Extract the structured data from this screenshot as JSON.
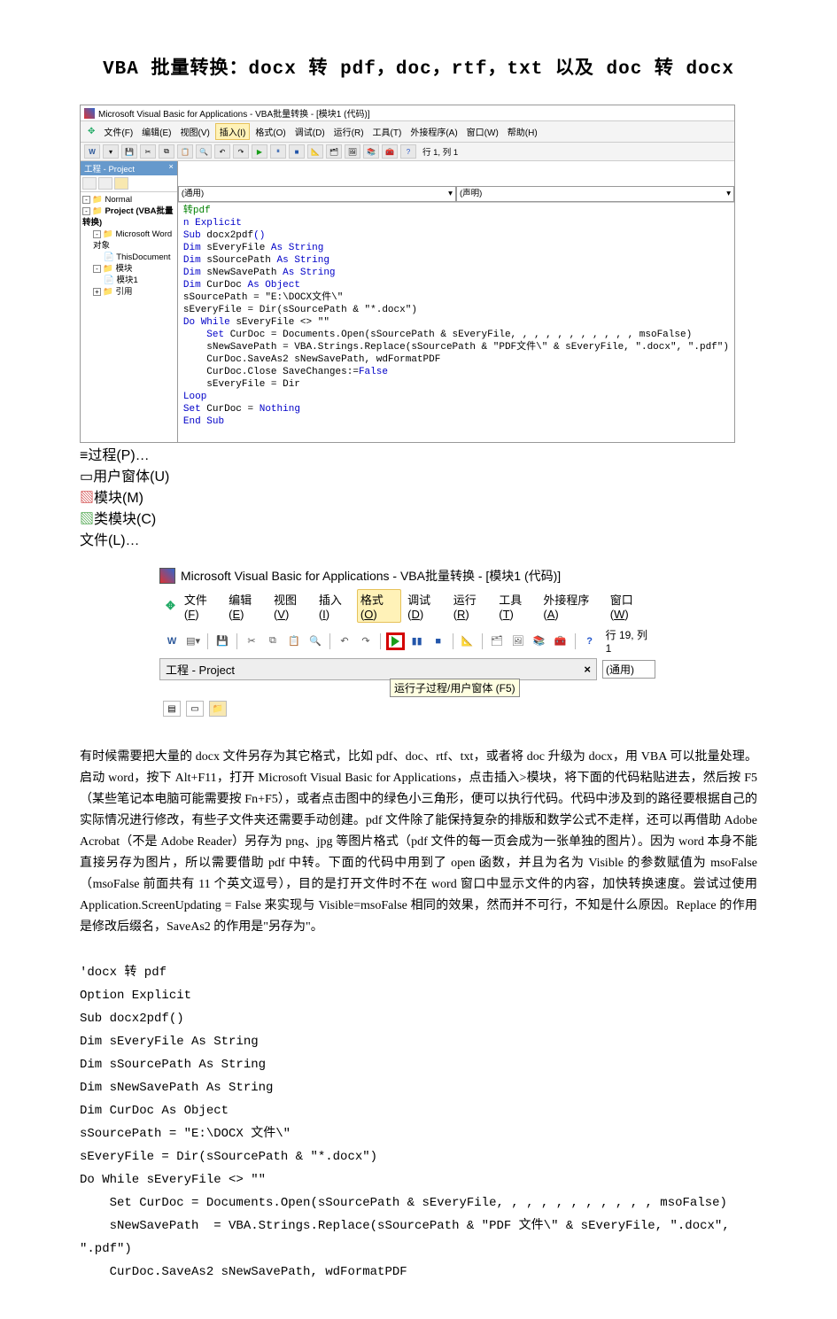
{
  "title": "VBA 批量转换：docx 转 pdf，doc，rtf，txt 以及 doc 转 docx",
  "ss1": {
    "window_title": "Microsoft Visual Basic for Applications - VBA批量转换 - [模块1 (代码)]",
    "menubar": [
      "文件(F)",
      "编辑(E)",
      "视图(V)",
      "插入(I)",
      "格式(O)",
      "调试(D)",
      "运行(R)",
      "工具(T)",
      "外接程序(A)",
      "窗口(W)",
      "帮助(H)"
    ],
    "cursor_pos": "行 1, 列 1",
    "sidebar_title": "工程 - Project",
    "tree": {
      "normal": "Normal",
      "project": "Project (VBA批量转换)",
      "word_obj": "Microsoft Word 对象",
      "thisdoc": "ThisDocument",
      "modules": "模块",
      "module1": "模块1",
      "refs": "引用"
    },
    "popup": {
      "row1": "过程(P)…",
      "row2": "用户窗体(U)",
      "row3": "模块(M)",
      "row4": "类模块(C)",
      "row5": "文件(L)…"
    },
    "dropdown_left": "(通用)",
    "dropdown_right": "(声明)",
    "code_lines": {
      "l1c": "转pdf",
      "l2": "n Explicit",
      "l3": "Sub docx2pdf()",
      "l4": "Dim sEveryFile As String",
      "l5": "Dim sSourcePath As String",
      "l6": "Dim sNewSavePath As String",
      "l7": "Dim CurDoc As Object",
      "l8": "sSourcePath = \"E:\\DOCX文件\\\"",
      "l9": "sEveryFile = Dir(sSourcePath & \"*.docx\")",
      "l10": "Do While sEveryFile <> \"\"",
      "l11": "    Set CurDoc = Documents.Open(sSourcePath & sEveryFile, , , , , , , , , , , msoFalse)",
      "l12": "    sNewSavePath = VBA.Strings.Replace(sSourcePath & \"PDF文件\\\" & sEveryFile, \".docx\", \".pdf\")",
      "l13": "    CurDoc.SaveAs2 sNewSavePath, wdFormatPDF",
      "l14": "    CurDoc.Close SaveChanges:=False",
      "l15": "    sEveryFile = Dir",
      "l16": "Loop",
      "l17": "Set CurDoc = Nothing",
      "l18": "End Sub"
    }
  },
  "ss2": {
    "window_title": "Microsoft Visual Basic for Applications - VBA批量转换 - [模块1 (代码)]",
    "menubar": [
      "文件(F)",
      "编辑(E)",
      "视图(V)",
      "插入(I)",
      "格式(O)",
      "调试(D)",
      "运行(R)",
      "工具(T)",
      "外接程序(A)",
      "窗口(W)"
    ],
    "project_header": "工程 - Project",
    "dropdown_left": "(通用)",
    "tooltip": "运行子过程/用户窗体 (F5)",
    "cursor_pos": "行 19, 列 1"
  },
  "body_text": "有时候需要把大量的 docx 文件另存为其它格式，比如 pdf、doc、rtf、txt，或者将 doc 升级为 docx，用 VBA 可以批量处理。启动 word，按下 Alt+F11，打开 Microsoft Visual Basic for Applications，点击插入>模块，将下面的代码粘贴进去，然后按 F5（某些笔记本电脑可能需要按 Fn+F5），或者点击图中的绿色小三角形，便可以执行代码。代码中涉及到的路径要根据自己的实际情况进行修改，有些子文件夹还需要手动创建。pdf 文件除了能保持复杂的排版和数学公式不走样，还可以再借助 Adobe Acrobat（不是 Adobe Reader）另存为 png、jpg 等图片格式（pdf 文件的每一页会成为一张单独的图片）。因为 word 本身不能直接另存为图片，所以需要借助 pdf 中转。下面的代码中用到了 open 函数，并且为名为 Visible 的参数赋值为 msoFalse（msoFalse 前面共有 11 个英文逗号），目的是打开文件时不在 word 窗口中显示文件的内容，加快转换速度。尝试过使用 Application.ScreenUpdating = False 来实现与 Visible=msoFalse 相同的效果，然而并不可行，不知是什么原因。Replace 的作用是修改后缀名，SaveAs2 的作用是\"另存为\"。",
  "code_block": "'docx 转 pdf\nOption Explicit\nSub docx2pdf()\nDim sEveryFile As String\nDim sSourcePath As String\nDim sNewSavePath As String\nDim CurDoc As Object\nsSourcePath = \"E:\\DOCX 文件\\\"\nsEveryFile = Dir(sSourcePath & \"*.docx\")\nDo While sEveryFile <> \"\"\n    Set CurDoc = Documents.Open(sSourcePath & sEveryFile, , , , , , , , , , , msoFalse)\n    sNewSavePath  = VBA.Strings.Replace(sSourcePath & \"PDF 文件\\\" & sEveryFile, \".docx\",\n\".pdf\")\n    CurDoc.SaveAs2 sNewSavePath, wdFormatPDF"
}
